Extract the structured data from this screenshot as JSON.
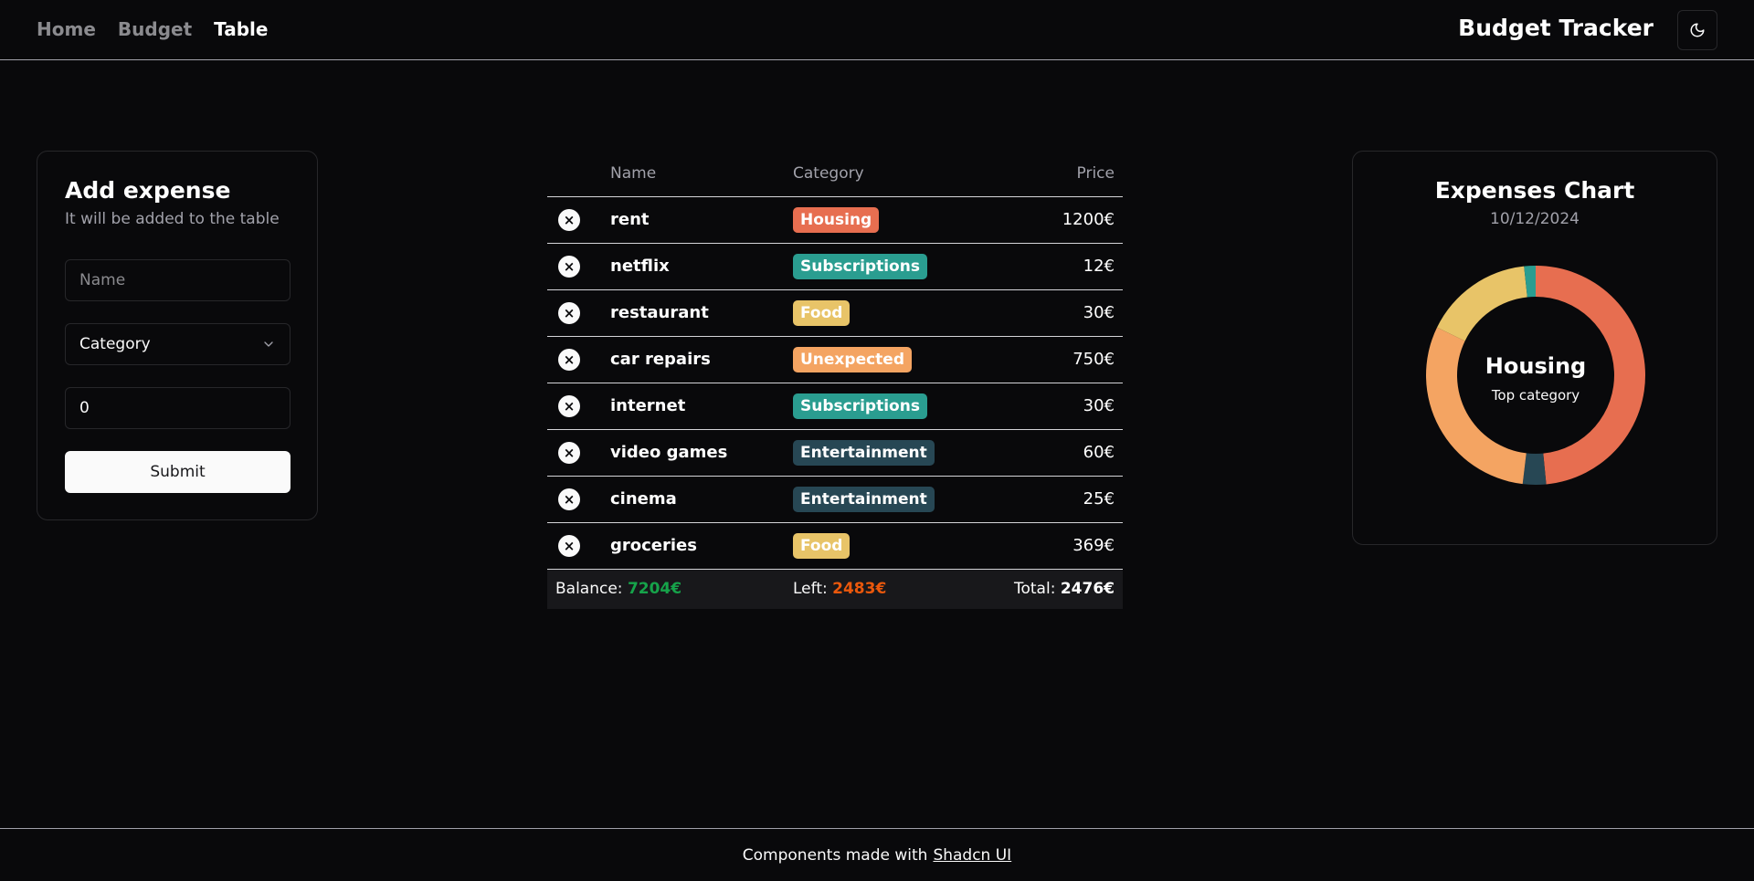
{
  "nav": {
    "home": "Home",
    "budget": "Budget",
    "table": "Table"
  },
  "brand": "Budget Tracker",
  "theme_icon": "moon-icon",
  "add_card": {
    "title": "Add expense",
    "description": "It will be added to the table",
    "name_placeholder": "Name",
    "category_placeholder": "Category",
    "price_value": "0",
    "submit_label": "Submit"
  },
  "table": {
    "headers": {
      "name": "Name",
      "category": "Category",
      "price": "Price"
    },
    "rows": [
      {
        "name": "rent",
        "category": "Housing",
        "price": "1200€"
      },
      {
        "name": "netflix",
        "category": "Subscriptions",
        "price": "12€"
      },
      {
        "name": "restaurant",
        "category": "Food",
        "price": "30€"
      },
      {
        "name": "car repairs",
        "category": "Unexpected",
        "price": "750€"
      },
      {
        "name": "internet",
        "category": "Subscriptions",
        "price": "30€"
      },
      {
        "name": "video games",
        "category": "Entertainment",
        "price": "60€"
      },
      {
        "name": "cinema",
        "category": "Entertainment",
        "price": "25€"
      },
      {
        "name": "groceries",
        "category": "Food",
        "price": "369€"
      }
    ],
    "footer": {
      "balance_label": "Balance:",
      "balance_value": "7204€",
      "left_label": "Left:",
      "left_value": "2483€",
      "total_label": "Total:",
      "total_value": "2476€"
    }
  },
  "category_colors": {
    "Housing": "#e76e50",
    "Subscriptions": "#2a9d90",
    "Food": "#e8c468",
    "Unexpected": "#f4a462",
    "Entertainment": "#274754"
  },
  "chart_card": {
    "title": "Expenses Chart",
    "date": "10/12/2024",
    "center_label": "Housing",
    "center_sublabel": "Top category"
  },
  "chart_data": {
    "type": "pie",
    "categories": [
      "Housing",
      "Entertainment",
      "Unexpected",
      "Food",
      "Subscriptions"
    ],
    "values": [
      1200,
      85,
      750,
      399,
      42
    ],
    "colors": [
      "#e76e50",
      "#274754",
      "#f4a462",
      "#e8c468",
      "#2a9d90"
    ]
  },
  "footer": {
    "text": "Components made with",
    "link": "Shadcn UI"
  }
}
